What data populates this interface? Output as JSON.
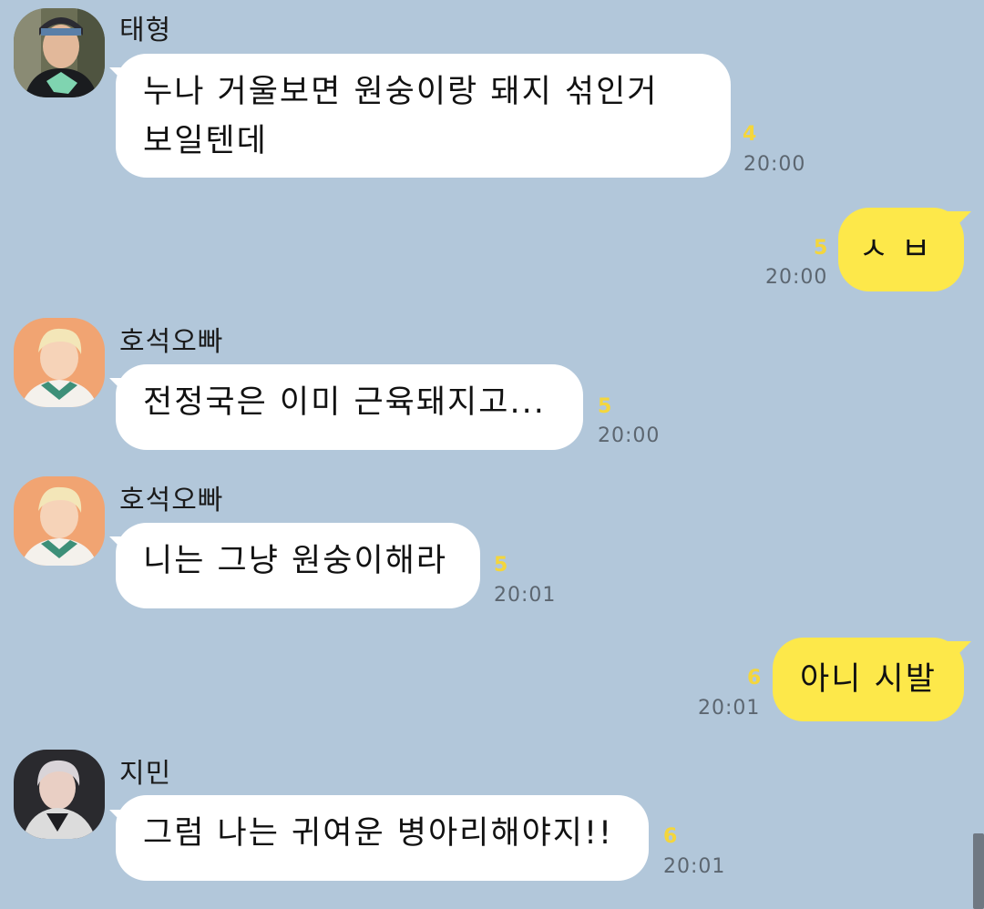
{
  "messages": [
    {
      "sender": "태형",
      "lines": [
        "누나 거울보면 원숭이랑 돼지 섞인거",
        "보일텐데"
      ],
      "unread": "4",
      "time": "20:00"
    },
    {
      "sender": "",
      "lines": [
        "ㅅㅂ"
      ],
      "unread": "5",
      "time": "20:00"
    },
    {
      "sender": "호석오빠",
      "lines": [
        "전정국은 이미 근육돼지고..."
      ],
      "unread": "5",
      "time": "20:00"
    },
    {
      "sender": "호석오빠",
      "lines": [
        "니는 그냥 원숭이해라"
      ],
      "unread": "5",
      "time": "20:01"
    },
    {
      "sender": "",
      "lines": [
        "아니 시발"
      ],
      "unread": "6",
      "time": "20:01"
    },
    {
      "sender": "지민",
      "lines": [
        "그럼 나는 귀여운 병아리해야지!!"
      ],
      "unread": "6",
      "time": "20:01"
    }
  ],
  "colors": {
    "background": "#b2c7da",
    "incoming_bubble": "#ffffff",
    "outgoing_bubble": "#fde84a",
    "unread": "#f4d63c"
  },
  "icons": [
    "avatar-taehyung",
    "avatar-hoseok",
    "avatar-jimin"
  ]
}
